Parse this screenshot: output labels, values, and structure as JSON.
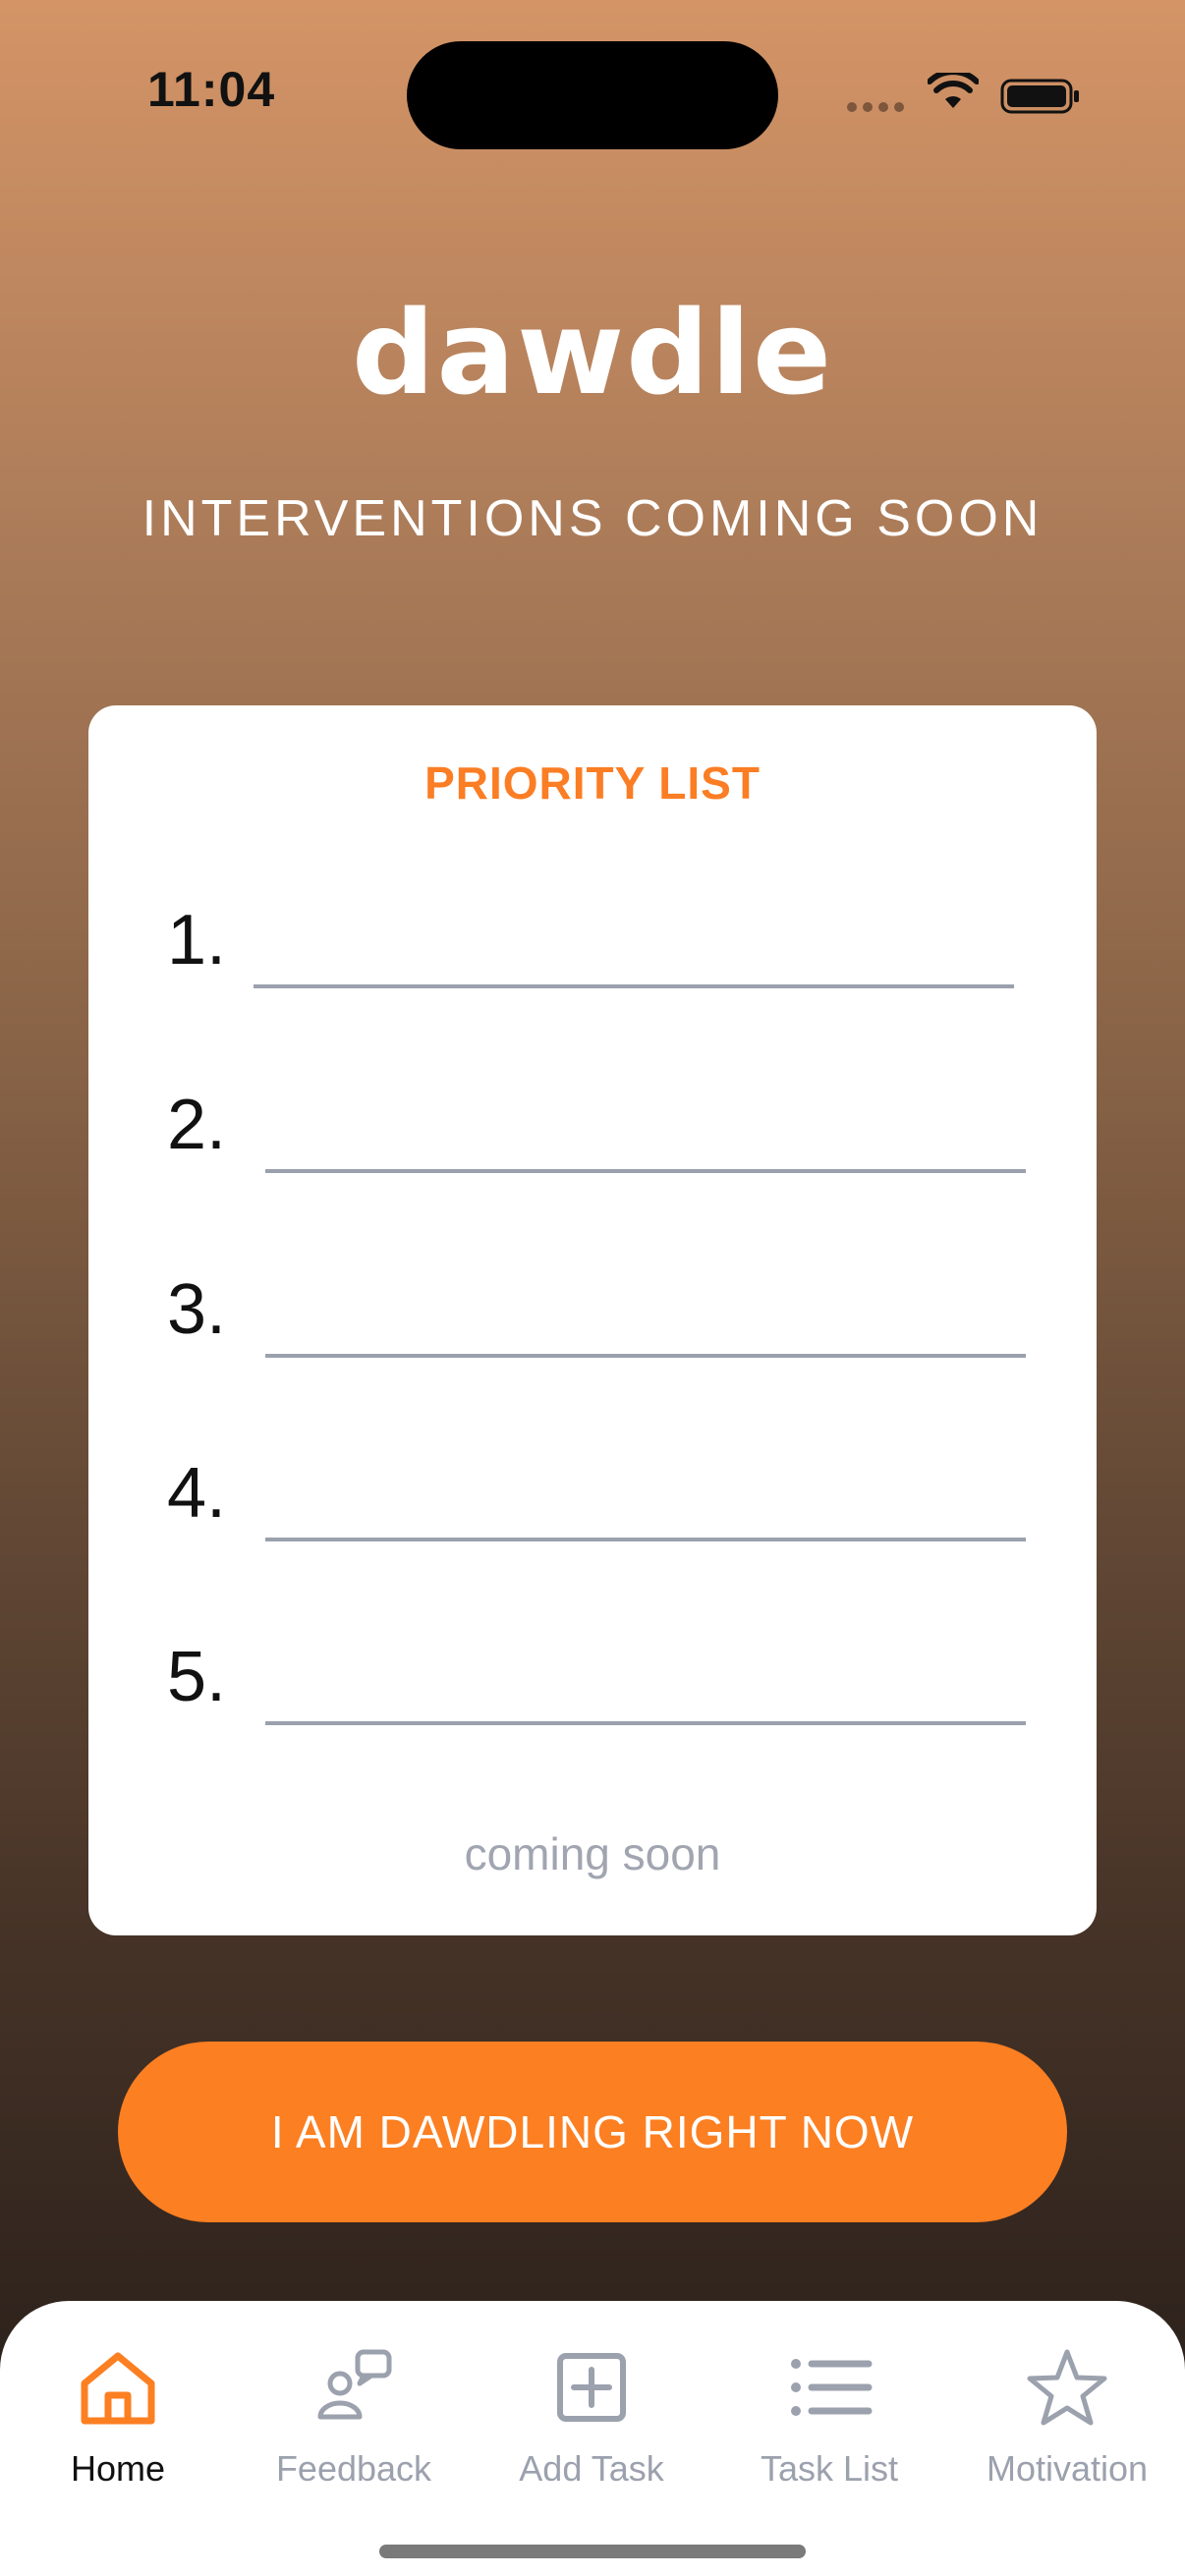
{
  "status_bar": {
    "time": "11:04",
    "wifi_icon": "wifi-icon",
    "battery_icon": "battery-icon"
  },
  "header": {
    "logo_text": "dawdle",
    "subtitle": "INTERVENTIONS COMING SOON"
  },
  "priority_card": {
    "title": "PRIORITY LIST",
    "items": [
      {
        "number": "1.",
        "value": ""
      },
      {
        "number": "2.",
        "value": ""
      },
      {
        "number": "3.",
        "value": ""
      },
      {
        "number": "4.",
        "value": ""
      },
      {
        "number": "5.",
        "value": ""
      }
    ],
    "footer": "coming soon"
  },
  "action_button": {
    "label": "I AM DAWDLING RIGHT NOW"
  },
  "tab_bar": {
    "active": "Home",
    "tabs": [
      {
        "label": "Home",
        "icon": "home-icon"
      },
      {
        "label": "Feedback",
        "icon": "feedback-icon"
      },
      {
        "label": "Add Task",
        "icon": "add-task-icon"
      },
      {
        "label": "Task List",
        "icon": "task-list-icon"
      },
      {
        "label": "Motivation",
        "icon": "star-icon"
      }
    ]
  },
  "colors": {
    "accent": "#fc7f22",
    "card_title": "#fb7d24",
    "inactive_tab": "#9ba1ad",
    "gradient_top": "#d49466",
    "gradient_bottom": "#241d19"
  }
}
